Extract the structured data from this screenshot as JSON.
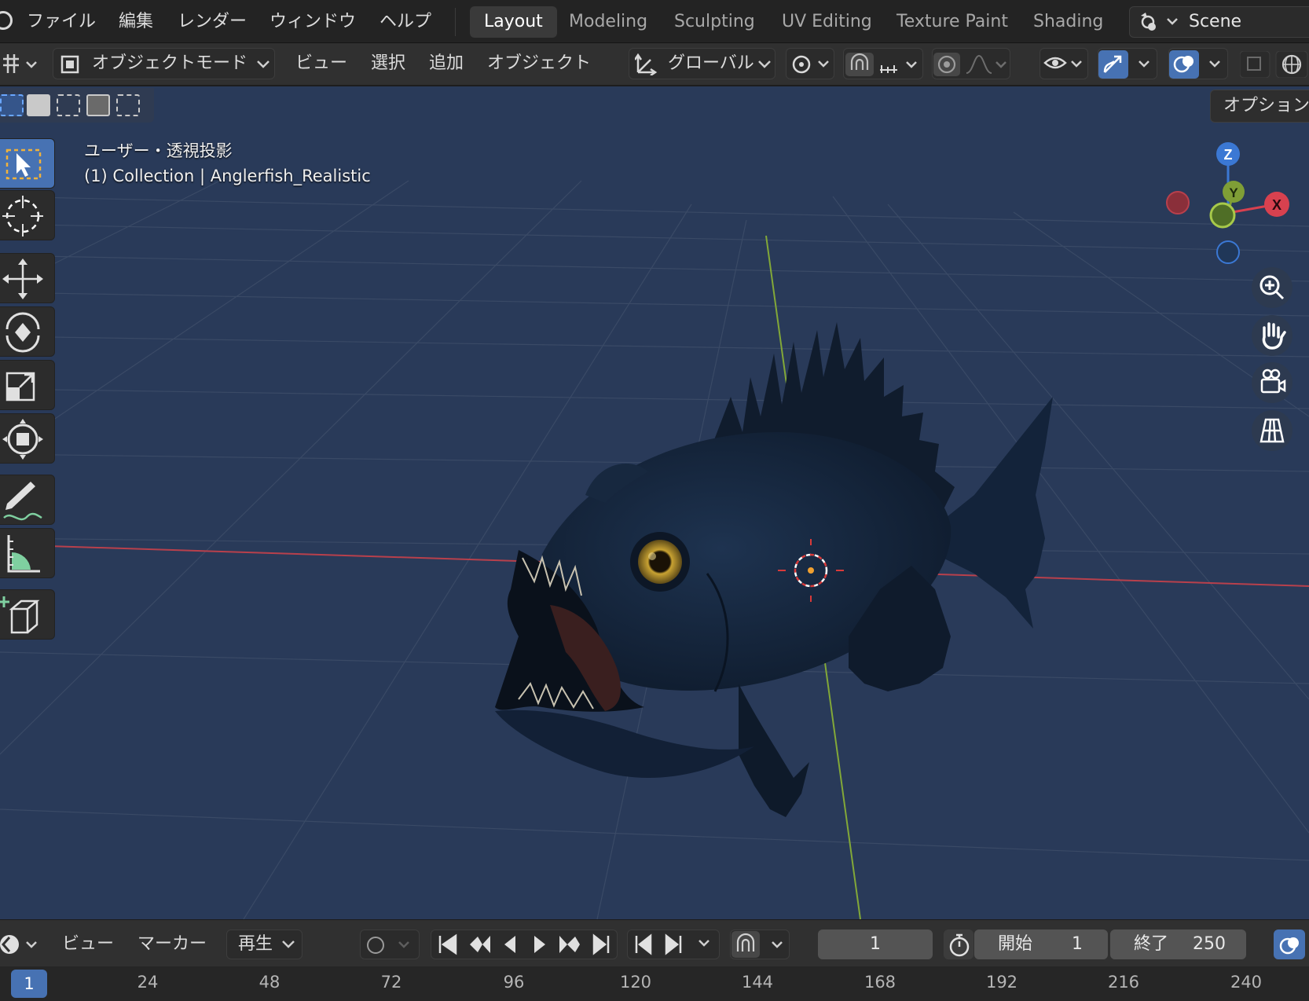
{
  "menu": {
    "items": [
      "ファイル",
      "編集",
      "レンダー",
      "ウィンドウ",
      "ヘルプ"
    ]
  },
  "workspaces": {
    "tabs": [
      "Layout",
      "Modeling",
      "Sculpting",
      "UV Editing",
      "Texture Paint",
      "Shading"
    ],
    "active": "Layout"
  },
  "scene": {
    "name": "Scene"
  },
  "header": {
    "mode": "オブジェクトモード",
    "menus": [
      "ビュー",
      "選択",
      "追加",
      "オブジェクト"
    ],
    "orientation": "グローバル"
  },
  "viewport": {
    "view_name": "ユーザー・透視投影",
    "object_info": "(1) Collection | Anglerfish_Realistic",
    "options_label": "オプション",
    "background_color": "#293a59",
    "gizmo_axes": [
      "Z",
      "Y",
      "X"
    ]
  },
  "timeline": {
    "menus": [
      "ビュー",
      "マーカー",
      "再生"
    ],
    "current_frame": "1",
    "start_label": "開始",
    "start_value": "1",
    "end_label": "終了",
    "end_value": "250",
    "ruler_frame": "1",
    "ruler_ticks": [
      "24",
      "48",
      "72",
      "96",
      "120",
      "144",
      "168",
      "192",
      "216",
      "240"
    ]
  },
  "colors": {
    "accent": "#4772b3",
    "x_axis": "#d8414f",
    "y_axis": "#7f9e36",
    "z_axis": "#3b78d4"
  }
}
